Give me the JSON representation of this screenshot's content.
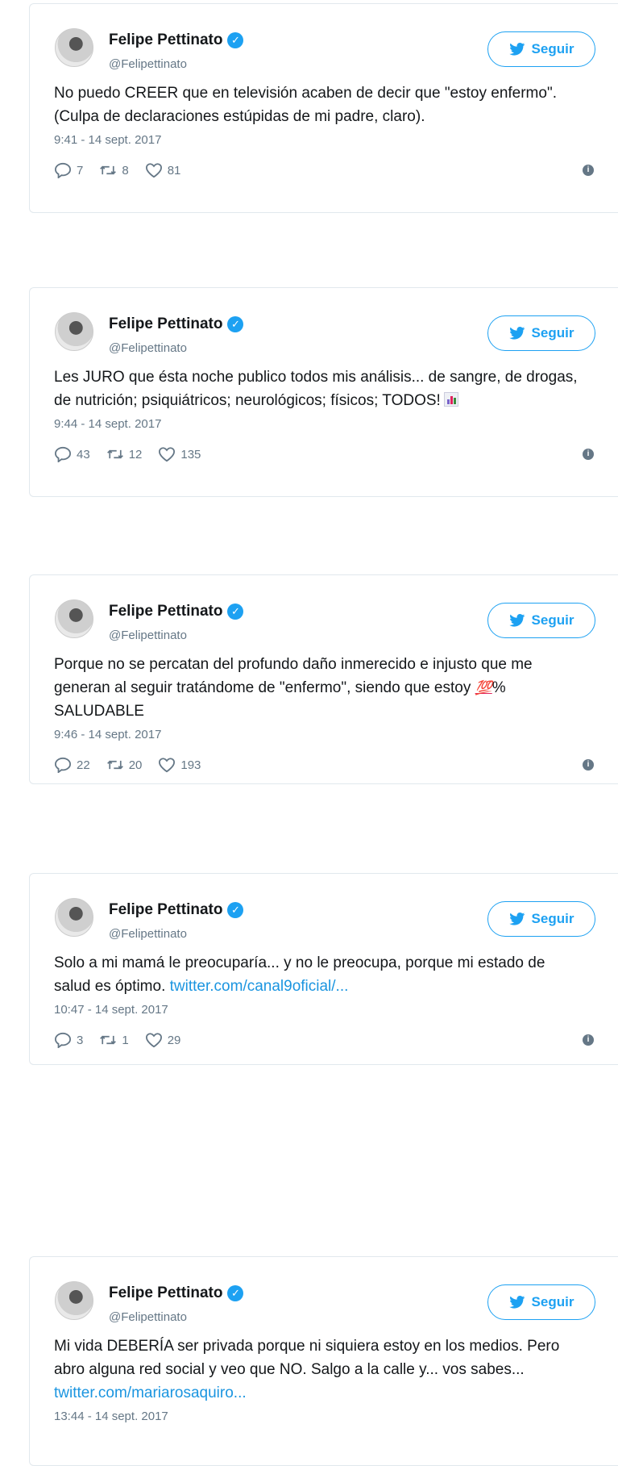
{
  "author": {
    "name": "Felipe Pettinato",
    "handle": "@Felipettinato",
    "follow_label": "Seguir"
  },
  "tweets": [
    {
      "text": "No puedo CREER que en televisión acaben de decir que \"estoy enfermo\". (Culpa de declaraciones estúpidas de mi padre, claro).",
      "time": "9:41 - 14 sept. 2017",
      "replies": "7",
      "retweets": "8",
      "likes": "81"
    },
    {
      "text": "Les JURO que ésta noche publico todos mis análisis... de sangre, de drogas, de nutrición; psiquiátricos; neurológicos; físicos; TODOS!",
      "emoji": "chart-emoji",
      "time": "9:44 - 14 sept. 2017",
      "replies": "43",
      "retweets": "12",
      "likes": "135"
    },
    {
      "text_before": "Porque no se percatan del profundo daño inmerecido e injusto que me generan al seguir tratándome de \"enfermo\", siendo que estoy ",
      "emoji_text": "💯",
      "text_after": "% SALUDABLE",
      "time": "9:46 - 14 sept. 2017",
      "replies": "22",
      "retweets": "20",
      "likes": "193"
    },
    {
      "text": "Solo a mi mamá le preocuparía... y no le preocupa, porque mi estado de salud es óptimo. ",
      "link": "twitter.com/canal9oficial/...",
      "time": "10:47 - 14 sept. 2017",
      "replies": "3",
      "retweets": "1",
      "likes": "29"
    },
    {
      "text": "Mi vida DEBERÍA ser privada porque ni siquiera estoy en los medios. Pero abro alguna red social y veo que NO. Salgo a la calle y... vos sabes... ",
      "link": "twitter.com/mariarosaquiro...",
      "time": "13:44 - 14 sept. 2017"
    }
  ],
  "colors": {
    "accent": "#1da1f2",
    "link": "#1b95e0",
    "muted": "#657786"
  },
  "icons": [
    "avatar",
    "verified-icon",
    "bird-icon",
    "reply-icon",
    "retweet-icon",
    "like-icon",
    "info-icon"
  ]
}
